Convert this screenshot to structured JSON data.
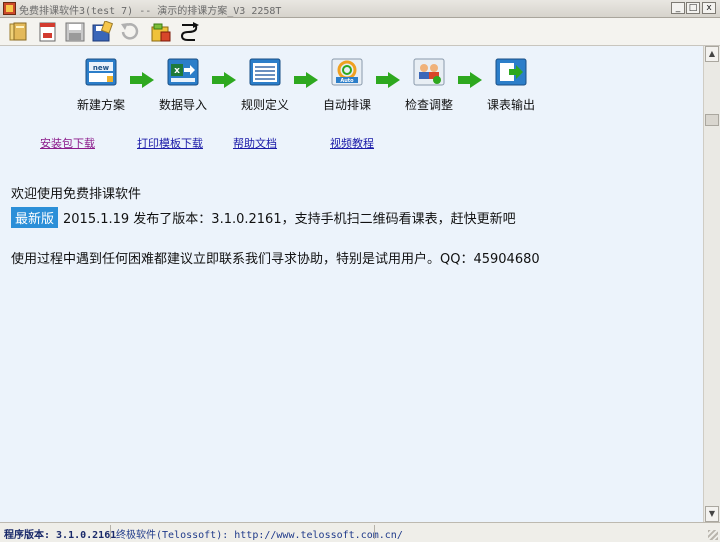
{
  "window": {
    "title": "免费排课软件3(test  7) -- 演示的排课方案_V3  2258T",
    "minimize": "_",
    "maximize": "□",
    "close": "x"
  },
  "toolbar": {
    "icons": [
      "open-folder-icon",
      "new-document-icon",
      "save-disk-icon",
      "save-as-icon",
      "undo-icon",
      "settings-lock-icon",
      "route-icon"
    ]
  },
  "workflow": {
    "steps": [
      {
        "label": "新建方案",
        "icon": "new-icon"
      },
      {
        "label": "数据导入",
        "icon": "excel-import-icon"
      },
      {
        "label": "规则定义",
        "icon": "rules-list-icon"
      },
      {
        "label": "自动排课",
        "icon": "auto-schedule-icon"
      },
      {
        "label": "检查调整",
        "icon": "check-users-icon"
      },
      {
        "label": "课表输出",
        "icon": "export-icon"
      }
    ],
    "arrow_color": "#2ea81f"
  },
  "links": {
    "installer": "安装包下载",
    "print_template": "打印模板下载",
    "help": "帮助文档",
    "video": "视频教程"
  },
  "content": {
    "welcome": "欢迎使用免费排课软件",
    "badge": "最新版",
    "release_note": "2015.1.19 发布了版本：3.1.0.2161，支持手机扫二维码看课表，赶快更新吧",
    "contact": "使用过程中遇到任何困难都建议立即联系我们寻求协助，特别是试用用户。QQ：45904680"
  },
  "statusbar": {
    "version": "程序版本: 3.1.0.2161",
    "company": "终极软件(Telossoft): http://www.telossoft.com.cn/"
  },
  "colors": {
    "badge_bg": "#2b8fd8",
    "link_installer": "#8b1a8b",
    "link_default": "#1a1aa8",
    "content_bg": "#ecf3fb"
  }
}
